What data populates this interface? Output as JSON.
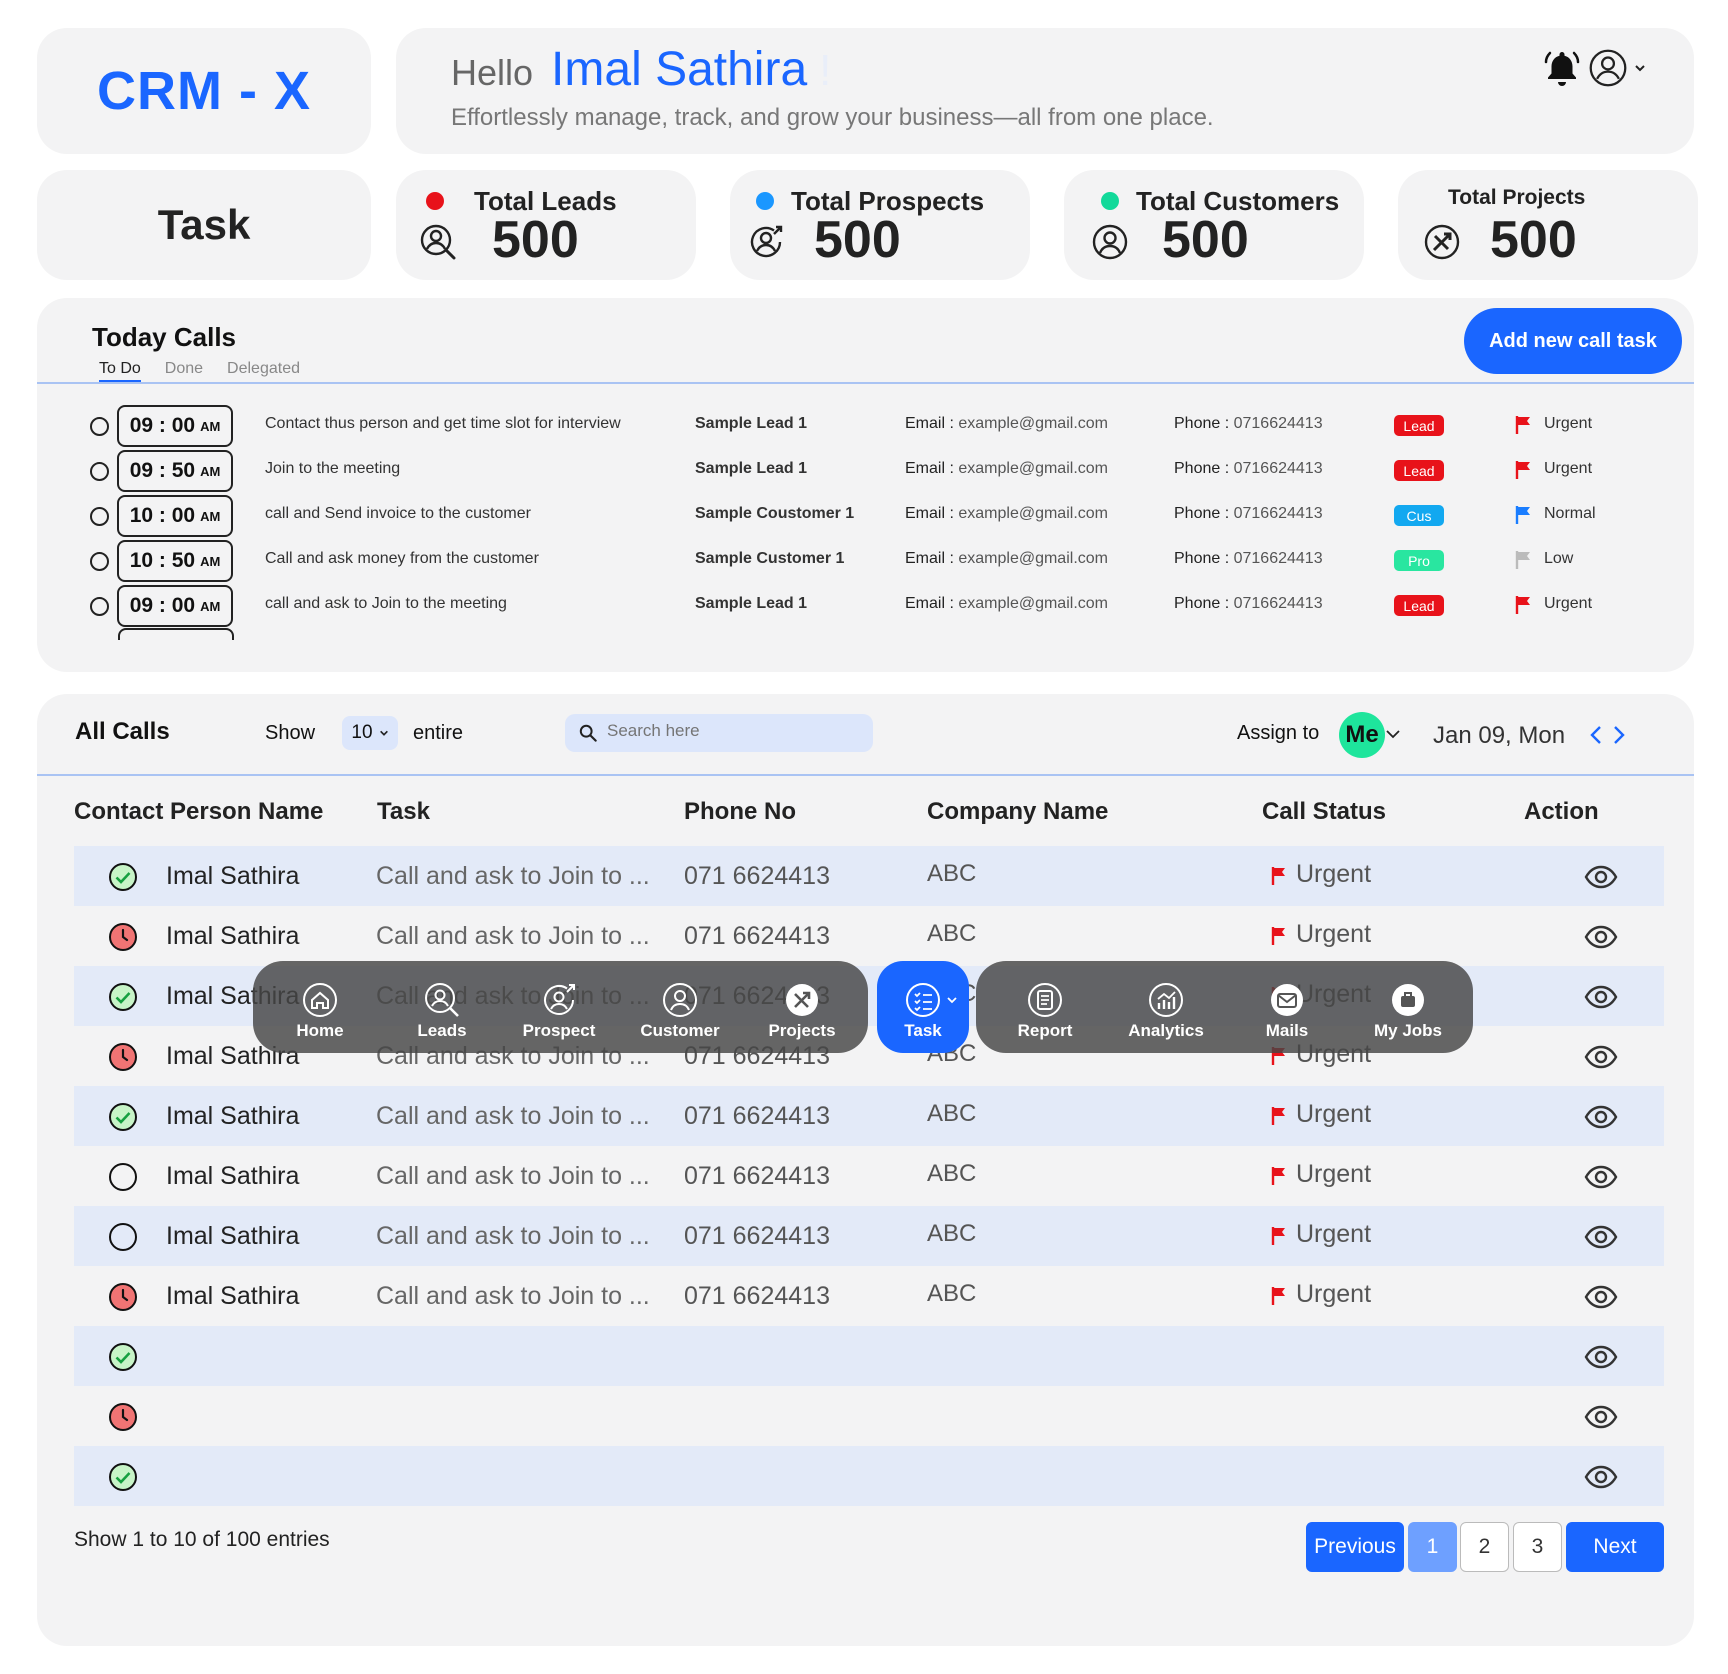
{
  "app": {
    "brand": "CRM - X"
  },
  "header": {
    "hello": "Hello",
    "user_name": "Imal Sathira",
    "exclaim": "!",
    "subtitle": "Effortlessly manage, track, and grow your business—all from one place."
  },
  "page": {
    "title": "Task"
  },
  "stats": [
    {
      "label": "Total Leads",
      "value": "500",
      "color": "#e8121a",
      "icon": "lead-search-icon"
    },
    {
      "label": "Total Prospects",
      "value": "500",
      "color": "#1a97ff",
      "icon": "prospect-icon"
    },
    {
      "label": "Total Customers",
      "value": "500",
      "color": "#12d99a",
      "icon": "customer-icon"
    },
    {
      "label": "Total Projects",
      "value": "500",
      "color": null,
      "icon": "projects-icon"
    }
  ],
  "today_calls": {
    "title": "Today Calls",
    "tabs": [
      "To Do",
      "Done",
      "Delegated"
    ],
    "add_button": "Add new call task",
    "email_label": "Email :",
    "phone_label": "Phone :",
    "rows": [
      {
        "time": "09 : 00",
        "ampm": "AM",
        "desc": "Contact thus person and get time slot for interview",
        "lead": "Sample Lead 1",
        "email": "example@gmail.com",
        "phone": "0716624413",
        "badge": "Lead",
        "badge_color": "#e8121a",
        "flag_color": "#e8121a",
        "priority": "Urgent"
      },
      {
        "time": "09 : 50",
        "ampm": "AM",
        "desc": "Join to the meeting",
        "lead": "Sample Lead 1",
        "email": "example@gmail.com",
        "phone": "0716624413",
        "badge": "Lead",
        "badge_color": "#e8121a",
        "flag_color": "#e8121a",
        "priority": "Urgent"
      },
      {
        "time": "10 : 00",
        "ampm": "AM",
        "desc": "call and Send invoice to the customer",
        "lead": "Sample Coustomer 1",
        "email": "example@gmail.com",
        "phone": "0716624413",
        "badge": "Cus",
        "badge_color": "#12a8f0",
        "flag_color": "#1a7dff",
        "priority": "Normal"
      },
      {
        "time": "10 : 50",
        "ampm": "AM",
        "desc": "Call and ask money from the customer",
        "lead": "Sample Customer 1",
        "email": "example@gmail.com",
        "phone": "0716624413",
        "badge": "Pro",
        "badge_color": "#29e6a0",
        "flag_color": "#bbbbbb",
        "priority": "Low"
      },
      {
        "time": "09 : 00",
        "ampm": "AM",
        "desc": "call and ask to Join to the meeting",
        "lead": "Sample Lead 1",
        "email": "example@gmail.com",
        "phone": "0716624413",
        "badge": "Lead",
        "badge_color": "#e8121a",
        "flag_color": "#e8121a",
        "priority": "Urgent"
      }
    ]
  },
  "all_calls": {
    "title": "All Calls",
    "show_label": "Show",
    "page_size": "10",
    "entire_label": "entire",
    "search_placeholder": "Search here",
    "assign_label": "Assign to",
    "assignee": "Me",
    "date": "Jan 09, Mon",
    "columns": [
      "Contact Person Name",
      "Task",
      "Phone No",
      "Company Name",
      "Call Status",
      "Action"
    ],
    "rows": [
      {
        "status": "done",
        "name": "Imal Sathira",
        "task": "Call and ask to Join to  ...",
        "phone": "071 6624413",
        "company": "ABC",
        "call_status": "Urgent"
      },
      {
        "status": "overdue",
        "name": "Imal Sathira",
        "task": "Call and ask to Join to  ...",
        "phone": "071 6624413",
        "company": "ABC",
        "call_status": "Urgent"
      },
      {
        "status": "done",
        "name": "Imal Sathira",
        "task": "Call and ask to Join to  ...",
        "phone": "071 6624413",
        "company": "ABC",
        "call_status": "Urgent"
      },
      {
        "status": "overdue",
        "name": "Imal Sathira",
        "task": "Call and ask to Join to  ...",
        "phone": "071 6624413",
        "company": "ABC",
        "call_status": "Urgent"
      },
      {
        "status": "done",
        "name": "Imal Sathira",
        "task": "Call and ask to Join to  ...",
        "phone": "071 6624413",
        "company": "ABC",
        "call_status": "Urgent"
      },
      {
        "status": "pending",
        "name": "Imal Sathira",
        "task": "Call and ask to Join to  ...",
        "phone": "071 6624413",
        "company": "ABC",
        "call_status": "Urgent"
      },
      {
        "status": "pending",
        "name": "Imal Sathira",
        "task": "Call and ask to Join to  ...",
        "phone": "071 6624413",
        "company": "ABC",
        "call_status": "Urgent"
      },
      {
        "status": "overdue",
        "name": "Imal Sathira",
        "task": "Call and ask to Join to  ...",
        "phone": "071 6624413",
        "company": "ABC",
        "call_status": "Urgent"
      },
      {
        "status": "done",
        "name": "",
        "task": "",
        "phone": "",
        "company": "",
        "call_status": ""
      },
      {
        "status": "overdue",
        "name": "",
        "task": "",
        "phone": "",
        "company": "",
        "call_status": ""
      },
      {
        "status": "done",
        "name": "",
        "task": "",
        "phone": "",
        "company": "",
        "call_status": ""
      }
    ],
    "footer": "Show 1 to 10 of 100 entries",
    "pagination": {
      "previous": "Previous",
      "pages": [
        "1",
        "2",
        "3"
      ],
      "current": "1",
      "next": "Next"
    }
  },
  "nav": {
    "items": [
      {
        "label": "Home",
        "icon": "home-icon"
      },
      {
        "label": "Leads",
        "icon": "leads-icon"
      },
      {
        "label": "Prospect",
        "icon": "prospect-icon"
      },
      {
        "label": "Customer",
        "icon": "customer-icon"
      },
      {
        "label": "Projects",
        "icon": "projects-icon"
      },
      {
        "label": "Task",
        "icon": "task-icon",
        "active": true
      },
      {
        "label": "Report",
        "icon": "report-icon"
      },
      {
        "label": "Analytics",
        "icon": "analytics-icon"
      },
      {
        "label": "Mails",
        "icon": "mail-icon"
      },
      {
        "label": "My Jobs",
        "icon": "my-jobs-icon"
      }
    ]
  },
  "colors": {
    "accent": "#1a66ff",
    "urgent": "#e8121a",
    "done": "#17b455",
    "overdue": "#e85a5a"
  }
}
